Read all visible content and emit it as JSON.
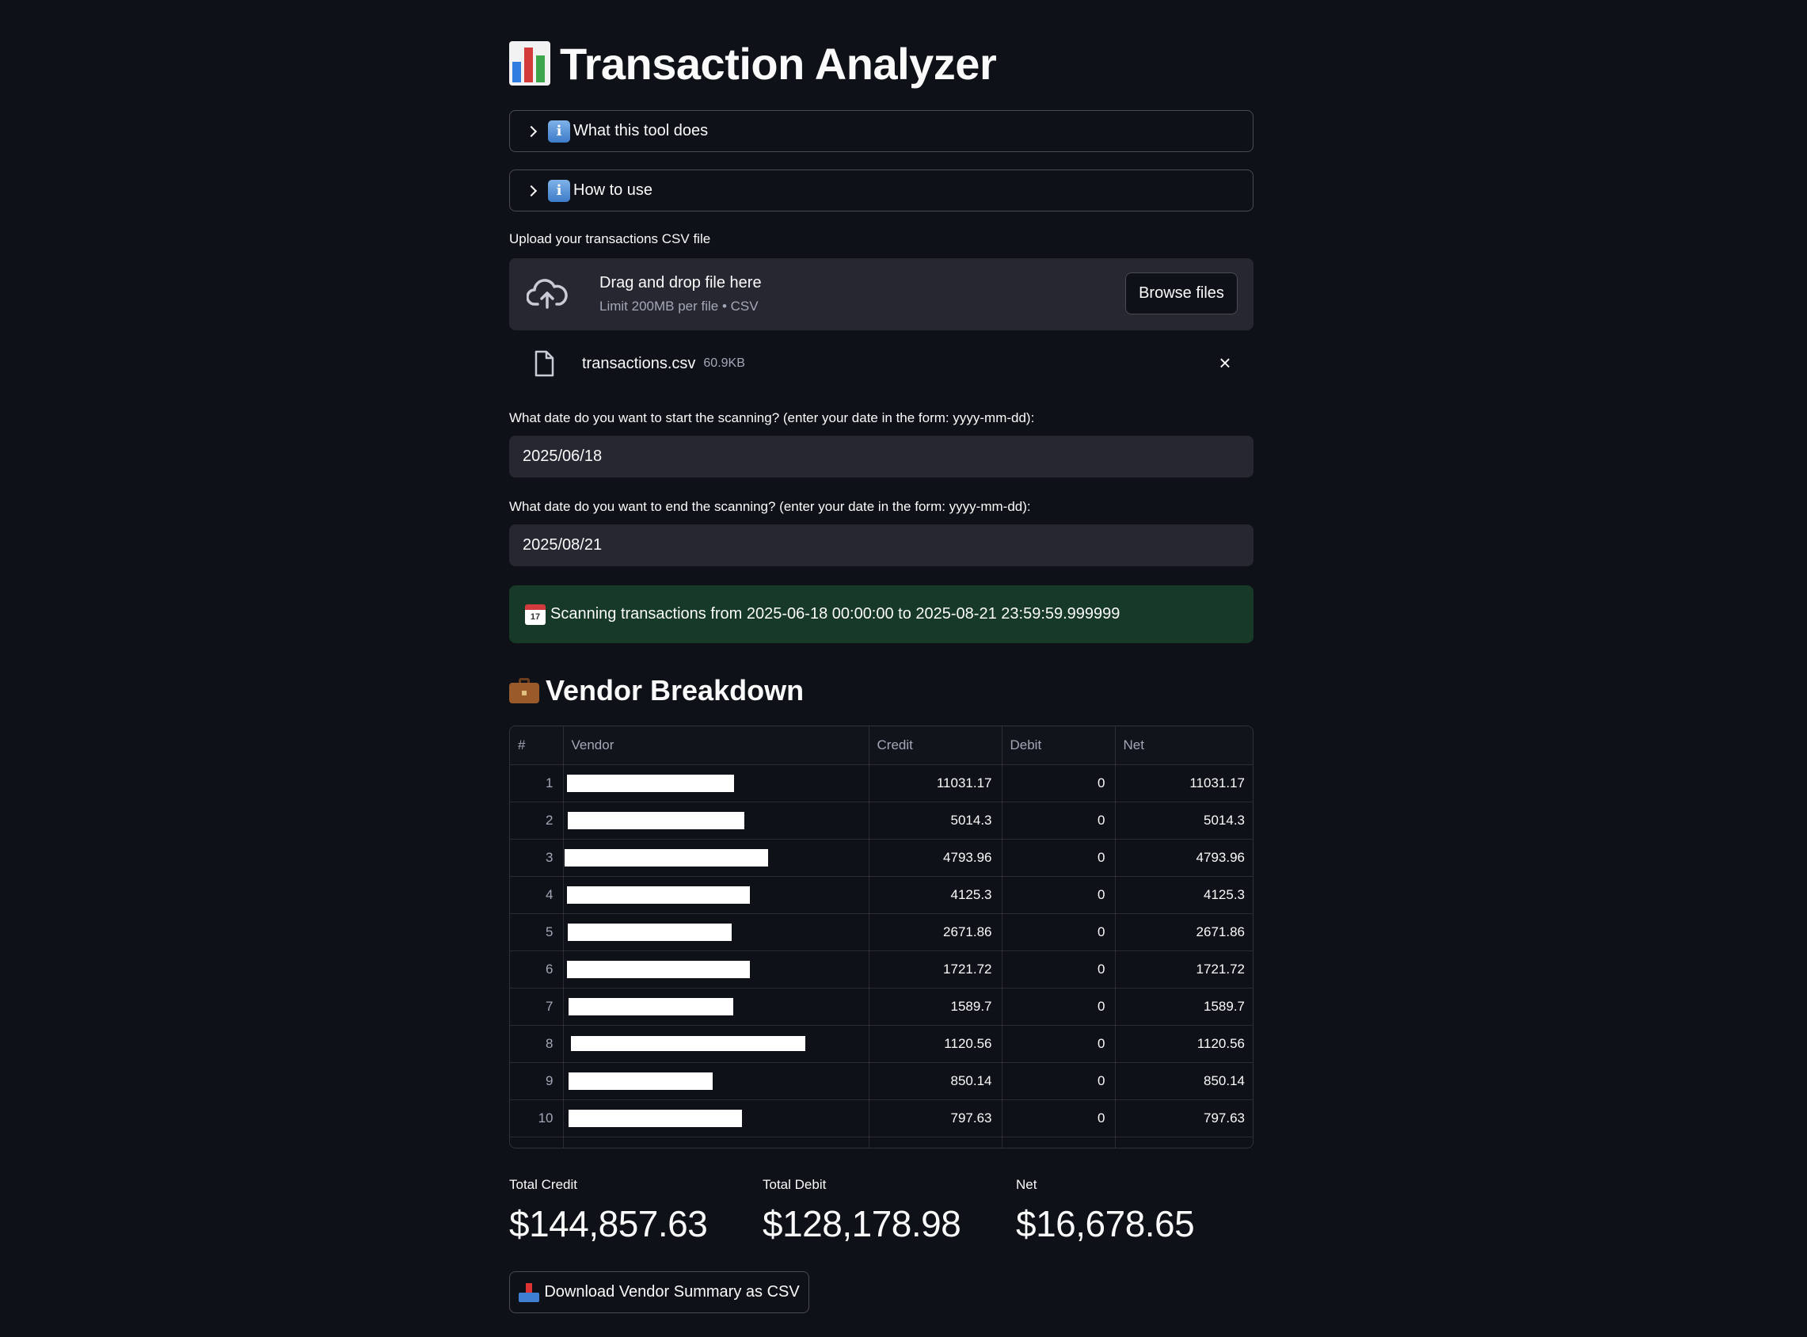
{
  "title": "Transaction Analyzer",
  "icons": {
    "title": "bar-chart-emoji",
    "info": "information-emoji",
    "upload": "cloud-upload-icon",
    "file": "file-icon",
    "close": "close-icon",
    "calendar": "calendar-emoji",
    "section": "briefcase-emoji",
    "download": "inbox-tray-emoji"
  },
  "expanders": [
    {
      "label": "What this tool does"
    },
    {
      "label": "How to use"
    }
  ],
  "uploader": {
    "label": "Upload your transactions CSV file",
    "drop_text": "Drag and drop file here",
    "limit_text": "Limit 200MB per file • CSV",
    "browse_label": "Browse files",
    "file_name": "transactions.csv",
    "file_size": "60.9KB"
  },
  "start_date": {
    "label": "What date do you want to start the scanning? (enter your date in the form: yyyy-mm-dd):",
    "value": "2025/06/18"
  },
  "end_date": {
    "label": "What date do you want to end the scanning? (enter your date in the form: yyyy-mm-dd):",
    "value": "2025/08/21"
  },
  "status_message": "Scanning transactions from 2025-06-18 00:00:00 to 2025-08-21 23:59:59.999999",
  "section_title": "Vendor Breakdown",
  "table": {
    "columns": [
      "#",
      "Vendor",
      "Credit",
      "Debit",
      "Net"
    ],
    "rows": [
      {
        "idx": "1",
        "credit": "11031.17",
        "debit": "0",
        "net": "11031.17"
      },
      {
        "idx": "2",
        "credit": "5014.3",
        "debit": "0",
        "net": "5014.3"
      },
      {
        "idx": "3",
        "credit": "4793.96",
        "debit": "0",
        "net": "4793.96"
      },
      {
        "idx": "4",
        "credit": "4125.3",
        "debit": "0",
        "net": "4125.3"
      },
      {
        "idx": "5",
        "credit": "2671.86",
        "debit": "0",
        "net": "2671.86"
      },
      {
        "idx": "6",
        "credit": "1721.72",
        "debit": "0",
        "net": "1721.72"
      },
      {
        "idx": "7",
        "credit": "1589.7",
        "debit": "0",
        "net": "1589.7"
      },
      {
        "idx": "8",
        "credit": "1120.56",
        "debit": "0",
        "net": "1120.56"
      },
      {
        "idx": "9",
        "credit": "850.14",
        "debit": "0",
        "net": "850.14"
      },
      {
        "idx": "10",
        "credit": "797.63",
        "debit": "0",
        "net": "797.63"
      }
    ]
  },
  "metrics": [
    {
      "label": "Total Credit",
      "value": "$144,857.63"
    },
    {
      "label": "Total Debit",
      "value": "$128,178.98"
    },
    {
      "label": "Net",
      "value": "$16,678.65"
    }
  ],
  "download_label": "Download Vendor Summary as CSV"
}
